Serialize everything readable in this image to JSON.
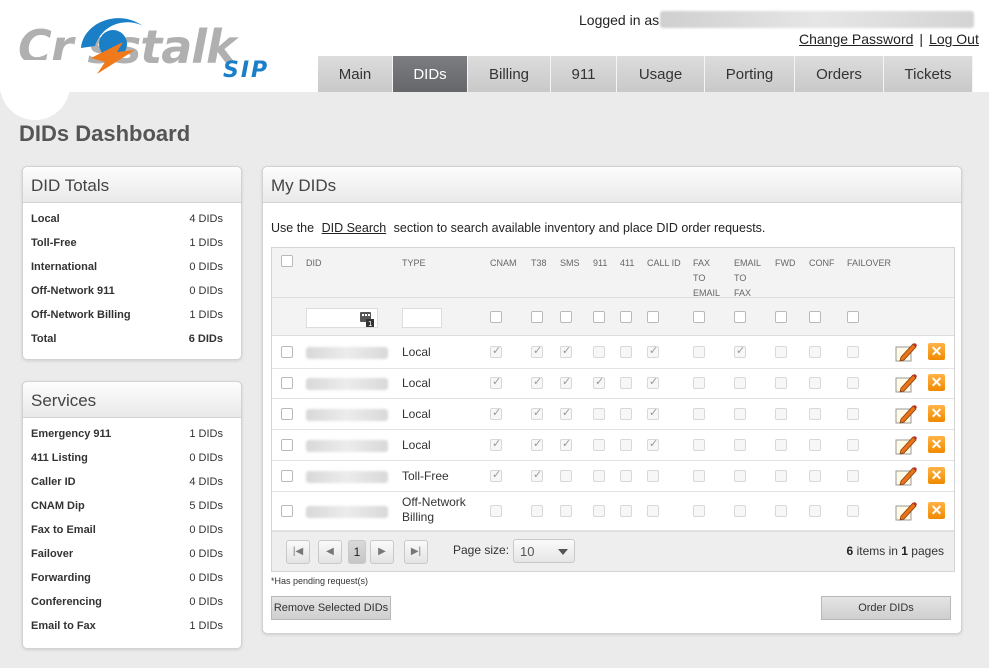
{
  "header": {
    "logo_text": "Cr  sstalk",
    "logo_sub": "SIP",
    "logged_in_label": "Logged in as",
    "change_password": "Change Password",
    "separator": "|",
    "logout": "Log Out"
  },
  "nav": {
    "tabs": [
      {
        "label": "Main",
        "active": false
      },
      {
        "label": "DIDs",
        "active": true
      },
      {
        "label": "Billing",
        "active": false
      },
      {
        "label": "911",
        "active": false
      },
      {
        "label": "Usage",
        "active": false
      },
      {
        "label": "Porting",
        "active": false
      },
      {
        "label": "Orders",
        "active": false
      },
      {
        "label": "Tickets",
        "active": false
      }
    ]
  },
  "page_title": "DIDs Dashboard",
  "did_totals": {
    "title": "DID Totals",
    "rows": [
      {
        "label": "Local",
        "value": "4 DIDs"
      },
      {
        "label": "Toll-Free",
        "value": "1 DIDs"
      },
      {
        "label": "International",
        "value": "0 DIDs"
      },
      {
        "label": "Off-Network 911",
        "value": "0 DIDs"
      },
      {
        "label": "Off-Network Billing",
        "value": "1 DIDs"
      },
      {
        "label": "Total",
        "value": "6 DIDs"
      }
    ]
  },
  "services": {
    "title": "Services",
    "rows": [
      {
        "label": "Emergency 911",
        "value": "1 DIDs"
      },
      {
        "label": "411 Listing",
        "value": "0 DIDs"
      },
      {
        "label": "Caller ID",
        "value": "4 DIDs"
      },
      {
        "label": "CNAM Dip",
        "value": "5 DIDs"
      },
      {
        "label": "Fax to Email",
        "value": "0 DIDs"
      },
      {
        "label": "Failover",
        "value": "0 DIDs"
      },
      {
        "label": "Forwarding",
        "value": "0 DIDs"
      },
      {
        "label": "Conferencing",
        "value": "0 DIDs"
      },
      {
        "label": "Email to Fax",
        "value": "1 DIDs"
      }
    ]
  },
  "my_dids": {
    "title": "My DIDs",
    "intro_before": "Use the",
    "intro_link": "DID Search",
    "intro_after": "section to search available inventory and place DID order requests.",
    "columns": [
      "DID",
      "TYPE",
      "CNAM",
      "T38",
      "SMS",
      "911",
      "411",
      "CALL ID",
      "FAX TO EMAIL",
      "EMAIL TO FAX",
      "FWD",
      "CONF",
      "FAILOVER"
    ],
    "rows": [
      {
        "type": "Local",
        "flags": [
          1,
          1,
          1,
          0,
          0,
          1,
          0,
          1,
          0,
          0,
          0
        ]
      },
      {
        "type": "Local",
        "flags": [
          1,
          1,
          1,
          1,
          0,
          1,
          0,
          0,
          0,
          0,
          0
        ]
      },
      {
        "type": "Local",
        "flags": [
          1,
          1,
          1,
          0,
          0,
          1,
          0,
          0,
          0,
          0,
          0
        ]
      },
      {
        "type": "Local",
        "flags": [
          1,
          1,
          1,
          0,
          0,
          1,
          0,
          0,
          0,
          0,
          0
        ]
      },
      {
        "type": "Toll-Free",
        "flags": [
          1,
          1,
          0,
          0,
          0,
          0,
          0,
          0,
          0,
          0,
          0
        ]
      },
      {
        "type": "Off-Network Billing",
        "flags": [
          0,
          0,
          0,
          0,
          0,
          0,
          0,
          0,
          0,
          0,
          0
        ]
      }
    ],
    "pager": {
      "current_page": "1",
      "page_size_label": "Page size:",
      "page_size": "10",
      "items_count": "6",
      "items_label": "items in",
      "pages_count": "1",
      "pages_label": "pages"
    },
    "pending_note": "*Has pending request(s)",
    "remove_button": "Remove Selected DIDs",
    "order_button": "Order DIDs"
  },
  "colors": {
    "active_tab": "#6e7073",
    "logo_blue": "#1a7fc7",
    "logo_orange": "#f07a1a",
    "delete_orange": "#f08a00"
  }
}
